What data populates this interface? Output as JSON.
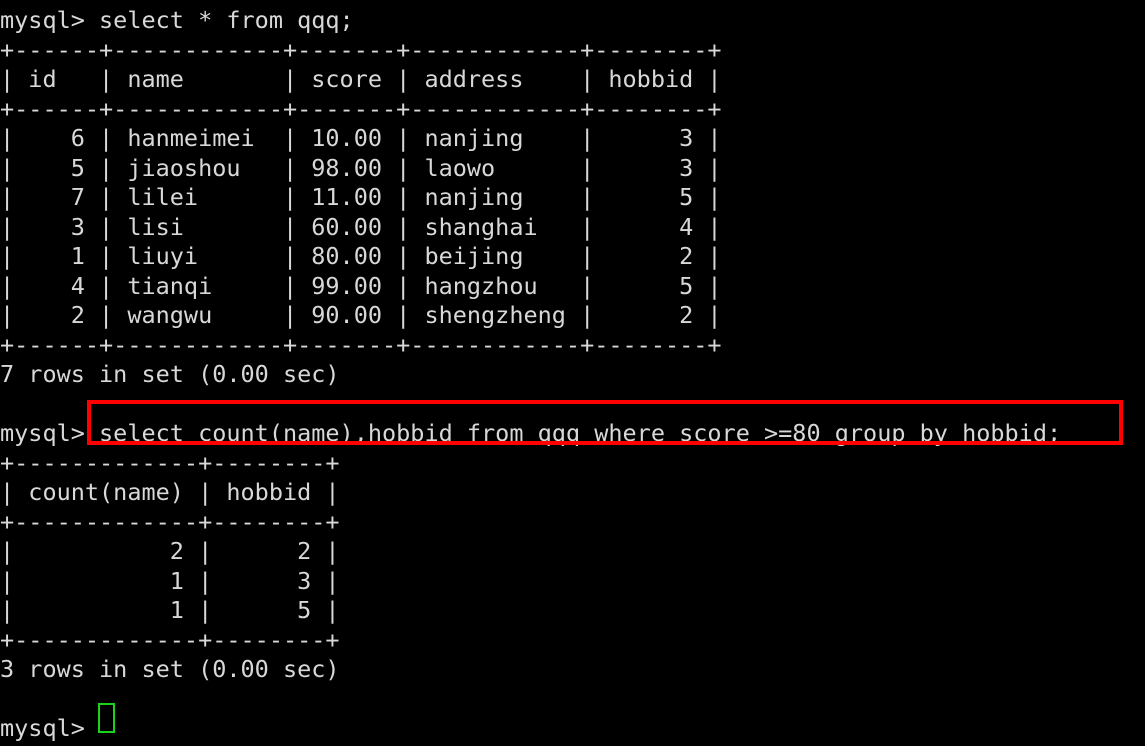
{
  "terminal": {
    "prompt": "mysql>",
    "background_color": "#000000",
    "text_color": "#d8d8d8",
    "highlight_color": "#ff0000",
    "cursor_color": "#19d419",
    "lines": [
      "mysql> select * from qqq;",
      "+------+------------+-------+------------+--------+",
      "| id   | name       | score | address    | hobbid |",
      "+------+------------+-------+------------+--------+",
      "|    6 | hanmeimei  | 10.00 | nanjing    |      3 |",
      "|    5 | jiaoshou   | 98.00 | laowo      |      3 |",
      "|    7 | lilei      | 11.00 | nanjing    |      5 |",
      "|    3 | lisi       | 60.00 | shanghai   |      4 |",
      "|    1 | liuyi      | 80.00 | beijing    |      2 |",
      "|    4 | tianqi     | 99.00 | hangzhou   |      5 |",
      "|    2 | wangwu     | 90.00 | shengzheng |      2 |",
      "+------+------------+-------+------------+--------+",
      "7 rows in set (0.00 sec)",
      "",
      "mysql> select count(name),hobbid from qqq where score >=80 group by hobbid;",
      "+-------------+--------+",
      "| count(name) | hobbid |",
      "+-------------+--------+",
      "|           2 |      2 |",
      "|           1 |      3 |",
      "|           1 |      5 |",
      "+-------------+--------+",
      "3 rows in set (0.00 sec)",
      "",
      "mysql> "
    ],
    "highlighted_command": "select count(name),hobbid from qqq where score >=80 group by hobbid;"
  },
  "query_1": {
    "command": "select * from qqq;",
    "table": {
      "columns": [
        "id",
        "name",
        "score",
        "address",
        "hobbid"
      ],
      "rows": [
        [
          "6",
          "hanmeimei",
          "10.00",
          "nanjing",
          "3"
        ],
        [
          "5",
          "jiaoshou",
          "98.00",
          "laowo",
          "3"
        ],
        [
          "7",
          "lilei",
          "11.00",
          "nanjing",
          "5"
        ],
        [
          "3",
          "lisi",
          "60.00",
          "shanghai",
          "4"
        ],
        [
          "1",
          "liuyi",
          "80.00",
          "beijing",
          "2"
        ],
        [
          "4",
          "tianqi",
          "99.00",
          "hangzhou",
          "5"
        ],
        [
          "2",
          "wangwu",
          "90.00",
          "shengzheng",
          "2"
        ]
      ]
    },
    "status": "7 rows in set (0.00 sec)",
    "row_count": 7,
    "elapsed": "0.00 sec"
  },
  "query_2": {
    "command": "select count(name),hobbid from qqq where score >=80 group by hobbid;",
    "table": {
      "columns": [
        "count(name)",
        "hobbid"
      ],
      "rows": [
        [
          "2",
          "2"
        ],
        [
          "1",
          "3"
        ],
        [
          "1",
          "5"
        ]
      ]
    },
    "status": "3 rows in set (0.00 sec)",
    "row_count": 3,
    "elapsed": "0.00 sec"
  }
}
